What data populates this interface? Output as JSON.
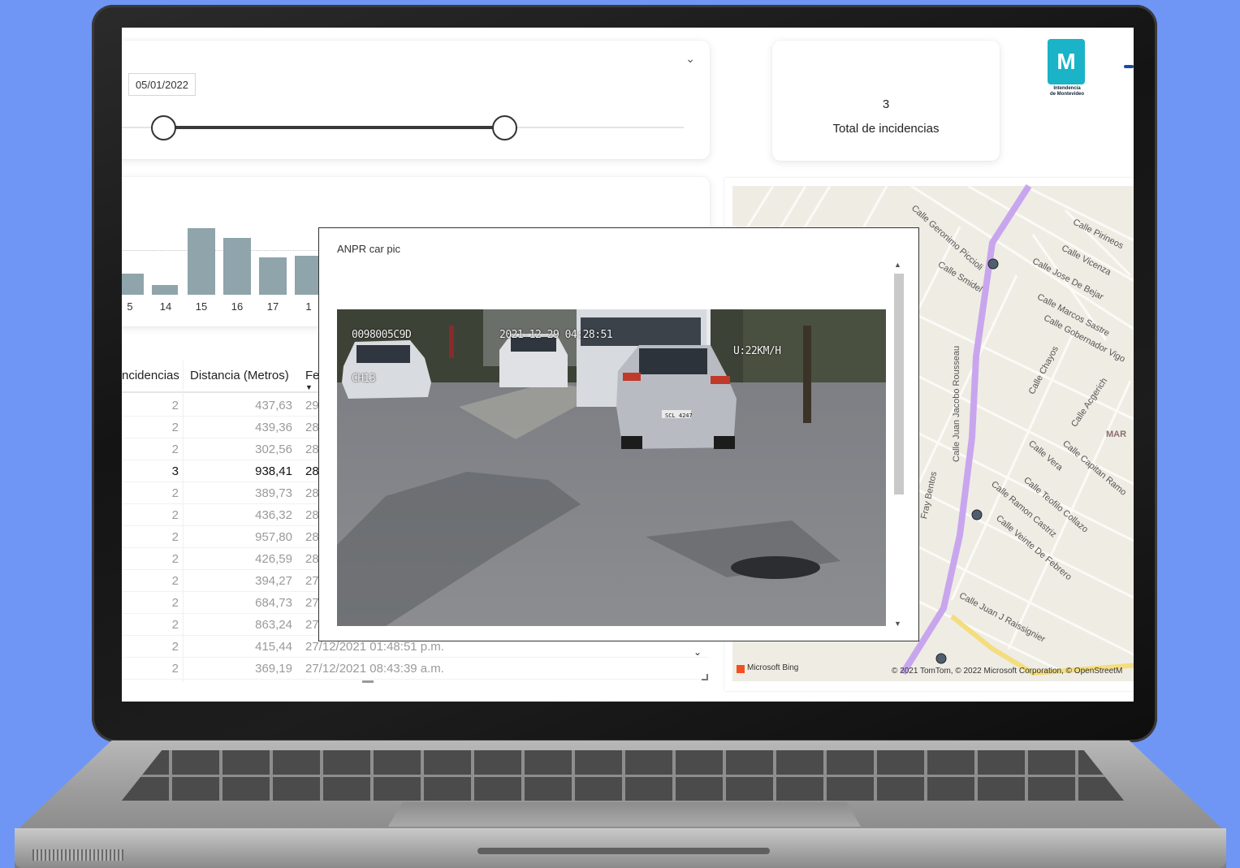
{
  "slicer": {
    "date_start": "05/01/2022",
    "range_start_fraction": 0.1,
    "range_end_fraction": 0.69
  },
  "kpi": {
    "value": "3",
    "label": "Total de incidencias"
  },
  "logo": {
    "glyph": "M",
    "text_line1": "Intendencia",
    "text_line2": "de Montevideo"
  },
  "chart_data": {
    "type": "bar",
    "categories": [
      "5",
      "14",
      "15",
      "16",
      "17",
      "1"
    ],
    "values": [
      22,
      10,
      68,
      58,
      38,
      40
    ],
    "ylim": [
      0,
      80
    ],
    "grid": false
  },
  "table": {
    "columns": [
      "ncidencias",
      "Distancia (Metros)",
      "Fe"
    ],
    "rows": [
      {
        "inc": "2",
        "dist": "437,63",
        "fecha": "29"
      },
      {
        "inc": "2",
        "dist": "439,36",
        "fecha": "28"
      },
      {
        "inc": "2",
        "dist": "302,56",
        "fecha": "28"
      },
      {
        "inc": "3",
        "dist": "938,41",
        "fecha": "28",
        "highlight": true
      },
      {
        "inc": "2",
        "dist": "389,73",
        "fecha": "28"
      },
      {
        "inc": "2",
        "dist": "436,32",
        "fecha": "28"
      },
      {
        "inc": "2",
        "dist": "957,80",
        "fecha": "28"
      },
      {
        "inc": "2",
        "dist": "426,59",
        "fecha": "28"
      },
      {
        "inc": "2",
        "dist": "394,27",
        "fecha": "27"
      },
      {
        "inc": "2",
        "dist": "684,73",
        "fecha": "27"
      },
      {
        "inc": "2",
        "dist": "863,24",
        "fecha": "27"
      },
      {
        "inc": "2",
        "dist": "415,44",
        "fecha": "27/12/2021 01:48:51 p.m."
      },
      {
        "inc": "2",
        "dist": "369,19",
        "fecha": "27/12/2021 08:43:39 a.m."
      }
    ]
  },
  "popup": {
    "title": "ANPR car pic",
    "osd_id": "0098005C9D",
    "osd_timestamp": "2021-12-29 04:28:51",
    "osd_speed": "U:22KM/H",
    "osd_channel": "CH13",
    "plate": "SCL 4247"
  },
  "map": {
    "streets": [
      "Calle Geronimo Piccioli",
      "Calle Pirineos",
      "Calle Vicenza",
      "Calle Jose De Bejar",
      "Calle Smidel",
      "Calle Marcos Sastre",
      "Calle Gobernador Vigo",
      "Calle Chayos",
      "Calle Acgerich",
      "Calle Juan Jacobo Rousseau",
      "Calle Vera",
      "Calle Capitan Ramo",
      "Calle Ramon Castriz",
      "Calle Teofilo Collazo",
      "Calle Veinte De Febrero",
      "Calle Juan J Raissignier",
      "Fray Bentos",
      "MAR"
    ],
    "bing_label": "Microsoft Bing",
    "attribution": "© 2021 TomTom, © 2022 Microsoft Corporation, © OpenStreetM",
    "road_color": "#c8a6ee",
    "road2_color": "#f3dd7f"
  },
  "colors": {
    "background": "#6f96f4",
    "bar": "#8fa4ab"
  }
}
